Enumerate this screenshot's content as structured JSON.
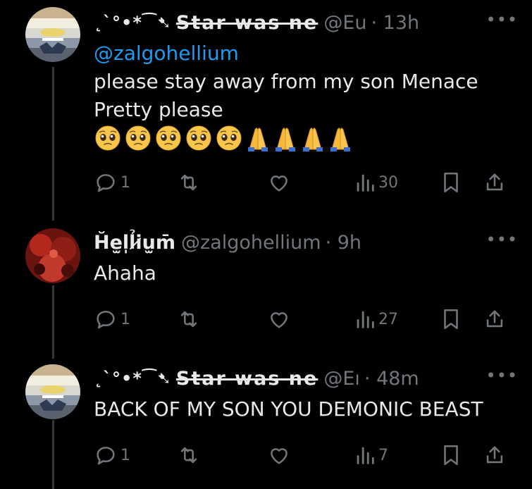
{
  "posts": [
    {
      "name": "Star was ne",
      "name_deco": "˛`°•*⁀➷",
      "handle": "@Eu",
      "time": "· 13h",
      "more": "•••",
      "mention": "@zalgohellium",
      "lines": [
        "please stay away from my son Menace",
        "Pretty please"
      ],
      "emojis": [
        "pleading-face",
        "pleading-face",
        "pleading-face",
        "pleading-face",
        "pleading-face",
        "folded-hands",
        "folded-hands",
        "folded-hands",
        "folded-hands"
      ],
      "actions": {
        "replies": "1",
        "reposts": "",
        "likes": "",
        "views": "30"
      }
    },
    {
      "name": "H̆e̫l̩l̉i̷u̫m̄",
      "handle": "@zalgohellium",
      "time": "· 9h",
      "more": "•••",
      "lines": [
        "Ahaha"
      ],
      "actions": {
        "replies": "1",
        "reposts": "",
        "likes": "",
        "views": "27"
      }
    },
    {
      "name": "Star was ne",
      "name_deco": "˛`°•*⁀➷",
      "handle": "@Eı",
      "time": "· 48m",
      "more": "•••",
      "lines": [
        "BACK OF MY SON YOU DEMONIC BEAST"
      ],
      "actions": {
        "replies": "1",
        "reposts": "",
        "likes": "",
        "views": "7"
      }
    }
  ],
  "icons": {
    "reply": "reply-icon",
    "repost": "repost-icon",
    "like": "heart-icon",
    "views": "views-icon",
    "bookmark": "bookmark-icon",
    "share": "share-icon"
  },
  "colors": {
    "background": "#000000",
    "text": "#e7e9ea",
    "muted": "#71767b",
    "link": "#1d9bf0",
    "thread_line": "#333639"
  }
}
